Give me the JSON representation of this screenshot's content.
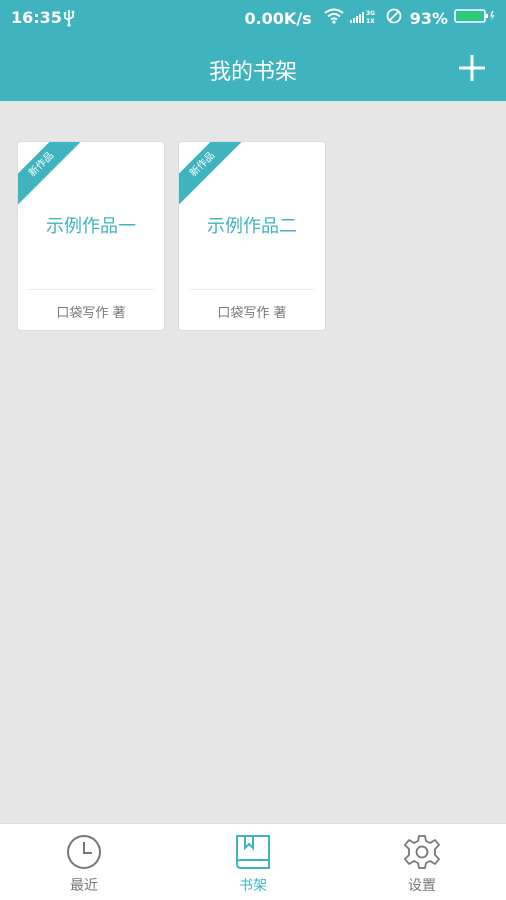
{
  "status_bar": {
    "time": "16:35",
    "net_speed": "0.00K/s",
    "battery": "93%",
    "battery_level": 0.93,
    "icons": [
      "usb-icon",
      "wifi-icon",
      "signal-icon",
      "do-not-disturb-icon",
      "battery-icon"
    ]
  },
  "header": {
    "title": "我的书架",
    "add_icon": "plus-icon"
  },
  "books": [
    {
      "badge": "新作品",
      "title": "示例作品一",
      "author": "口袋写作 著"
    },
    {
      "badge": "新作品",
      "title": "示例作品二",
      "author": "口袋写作 著"
    }
  ],
  "tabs": [
    {
      "label": "最近",
      "icon": "clock-icon",
      "active": false
    },
    {
      "label": "书架",
      "icon": "book-icon",
      "active": true
    },
    {
      "label": "设置",
      "icon": "gear-icon",
      "active": false
    }
  ],
  "colors": {
    "accent": "#3fb4be",
    "background": "#e6e6e6",
    "card": "#ffffff",
    "inactive_tab": "#777777"
  }
}
